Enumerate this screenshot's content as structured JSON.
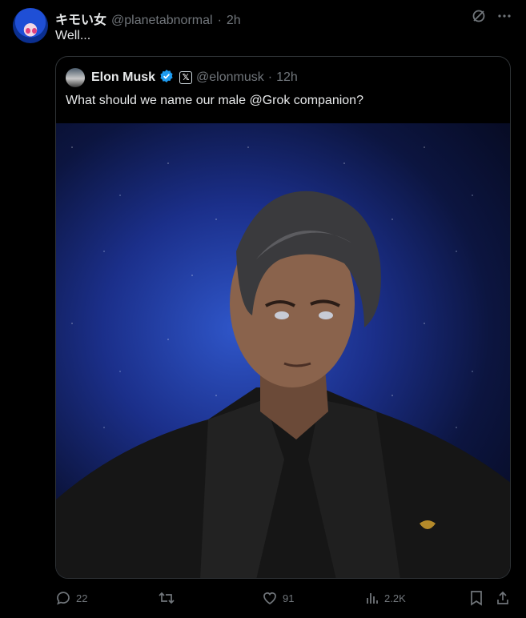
{
  "tweet": {
    "author_name": "キモい女",
    "handle": "@planetabnormal",
    "separator": "·",
    "time": "2h",
    "text": "Well..."
  },
  "quoted": {
    "author_name": "Elon Musk",
    "x_badge": "𝕏",
    "handle": "@elonmusk",
    "separator": "·",
    "time": "12h",
    "text": "What should we name our male @Grok companion?"
  },
  "actions": {
    "replies": "22",
    "likes": "91",
    "views": "2.2K"
  },
  "colors": {
    "background": "#000000",
    "text_primary": "#e7e9ea",
    "text_secondary": "#71767b",
    "verified": "#1d9bf0",
    "border": "#2f3336"
  },
  "icons": [
    "grok-icon",
    "more-icon",
    "verified-icon",
    "reply-icon",
    "retweet-icon",
    "like-icon",
    "views-icon",
    "bookmark-icon",
    "share-icon"
  ]
}
